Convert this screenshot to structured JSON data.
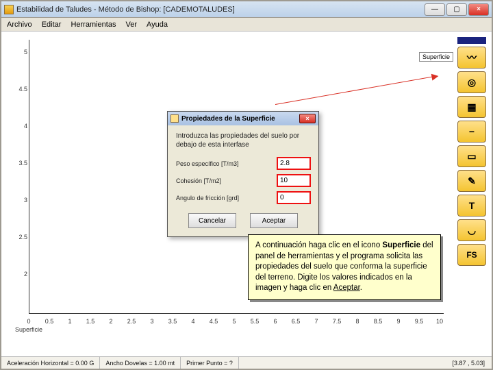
{
  "titlebar": {
    "title": "Estabilidad de Taludes - Método de Bishop: [CADEMOTALUDES]"
  },
  "menu": [
    "Archivo",
    "Editar",
    "Herramientas",
    "Ver",
    "Ayuda"
  ],
  "chart_data": {
    "type": "scatter",
    "title": "",
    "xlabel": "Superficie",
    "ylabel": "",
    "xlim": [
      0,
      10
    ],
    "ylim": [
      0,
      5
    ],
    "xticks": [
      0,
      0.5,
      1,
      1.5,
      2,
      2.5,
      3,
      3.5,
      4,
      4.5,
      5,
      5.5,
      6,
      6.5,
      7,
      7.5,
      8,
      8.5,
      9,
      9.5,
      10
    ],
    "yticks": [
      2,
      2.5,
      3,
      3.5,
      4,
      4.5,
      5
    ],
    "series": []
  },
  "toolbox": {
    "tooltip_label": "Superficie",
    "buttons": [
      "surface",
      "circles",
      "grid",
      "line",
      "box",
      "pencil",
      "text",
      "arc",
      "fs"
    ],
    "glyphs": {
      "surface": "〰",
      "circles": "◎",
      "grid": "▦",
      "line": "−",
      "box": "▭",
      "pencil": "✎",
      "text": "T",
      "arc": "◡",
      "fs": "FS"
    }
  },
  "dialog": {
    "title": "Propiedades de la Superficie",
    "intro": "Introduzca las propiedades del suelo por debajo de esta interfase",
    "rows": [
      {
        "label": "Peso específico [T/m3]",
        "value": "2.8"
      },
      {
        "label": "Cohesión [T/m2]",
        "value": "10"
      },
      {
        "label": "Angulo de fricción [grd]",
        "value": "0"
      }
    ],
    "cancel": "Cancelar",
    "accept": "Aceptar"
  },
  "tip": {
    "l1": "A continuación haga clic en el icono ",
    "bold": "Superficie",
    "l2": " del panel de herramientas y el programa solicita las propiedades del suelo que conforma la superficie del terreno. Digite los valores indicados en la imagen y haga clic en ",
    "accept": "Aceptar",
    "period": "."
  },
  "status": {
    "cell1": "Aceleración Horizontal = 0.00 G",
    "cell2": "Ancho Dovelas = 1.00 mt",
    "cell3": "Primer Punto = ?",
    "coord": "[3.87 , 5.03]"
  }
}
